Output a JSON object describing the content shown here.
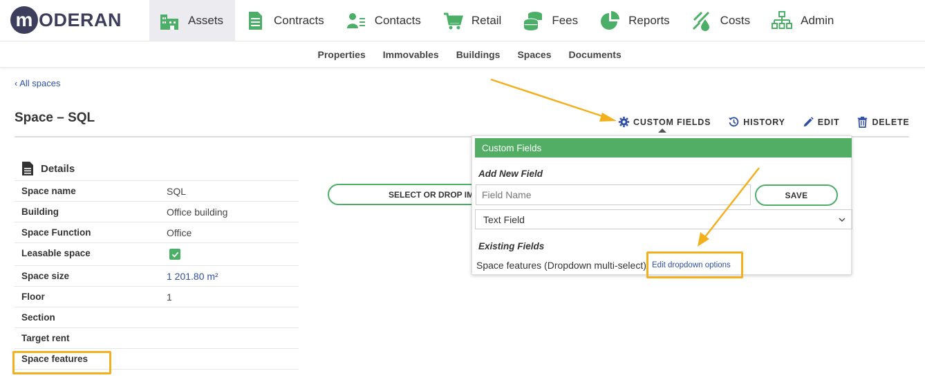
{
  "brand": {
    "logo_letter": "m",
    "logo_text": "ODERAN"
  },
  "nav": [
    {
      "label": "Assets",
      "icon": "building-icon",
      "active": true
    },
    {
      "label": "Contracts",
      "icon": "document-icon",
      "active": false
    },
    {
      "label": "Contacts",
      "icon": "contacts-icon",
      "active": false
    },
    {
      "label": "Retail",
      "icon": "cart-icon",
      "active": false
    },
    {
      "label": "Fees",
      "icon": "coins-icon",
      "active": false
    },
    {
      "label": "Reports",
      "icon": "pie-chart-icon",
      "active": false
    },
    {
      "label": "Costs",
      "icon": "costs-icon",
      "active": false
    },
    {
      "label": "Admin",
      "icon": "org-chart-icon",
      "active": false
    }
  ],
  "subnav": [
    "Properties",
    "Immovables",
    "Buildings",
    "Spaces",
    "Documents"
  ],
  "breadcrumb": {
    "back": "All spaces",
    "back_glyph": "‹"
  },
  "page": {
    "title": "Space – SQL"
  },
  "actions": {
    "custom_fields": "CUSTOM FIELDS",
    "history": "HISTORY",
    "edit": "EDIT",
    "delete": "DELETE"
  },
  "details": {
    "heading": "Details",
    "rows": [
      {
        "label": "Space name",
        "value": "SQL"
      },
      {
        "label": "Building",
        "value": "Office building"
      },
      {
        "label": "Space Function",
        "value": "Office"
      },
      {
        "label": "Leasable space",
        "value": "",
        "checked": true
      },
      {
        "label": "Space size",
        "value": "1 201.80 m²"
      },
      {
        "label": "Floor",
        "value": "1"
      },
      {
        "label": "Section",
        "value": ""
      },
      {
        "label": "Target rent",
        "value": ""
      },
      {
        "label": "Space features",
        "value": ""
      }
    ]
  },
  "upload": {
    "label": "SELECT OR DROP IMA"
  },
  "custom_fields_popup": {
    "title": "Custom Fields",
    "add_new_heading": "Add New Field",
    "field_name_placeholder": "Field Name",
    "save_label": "SAVE",
    "type_selected": "Text Field",
    "existing_heading": "Existing Fields",
    "existing_field": "Space features (Dropdown multi-select)",
    "edit_options_link": "Edit dropdown options"
  },
  "colors": {
    "accent_green": "#52ad65",
    "highlight": "#f2b01e",
    "link_blue": "#2e4fa3",
    "brand_navy": "#3d3d5c"
  }
}
